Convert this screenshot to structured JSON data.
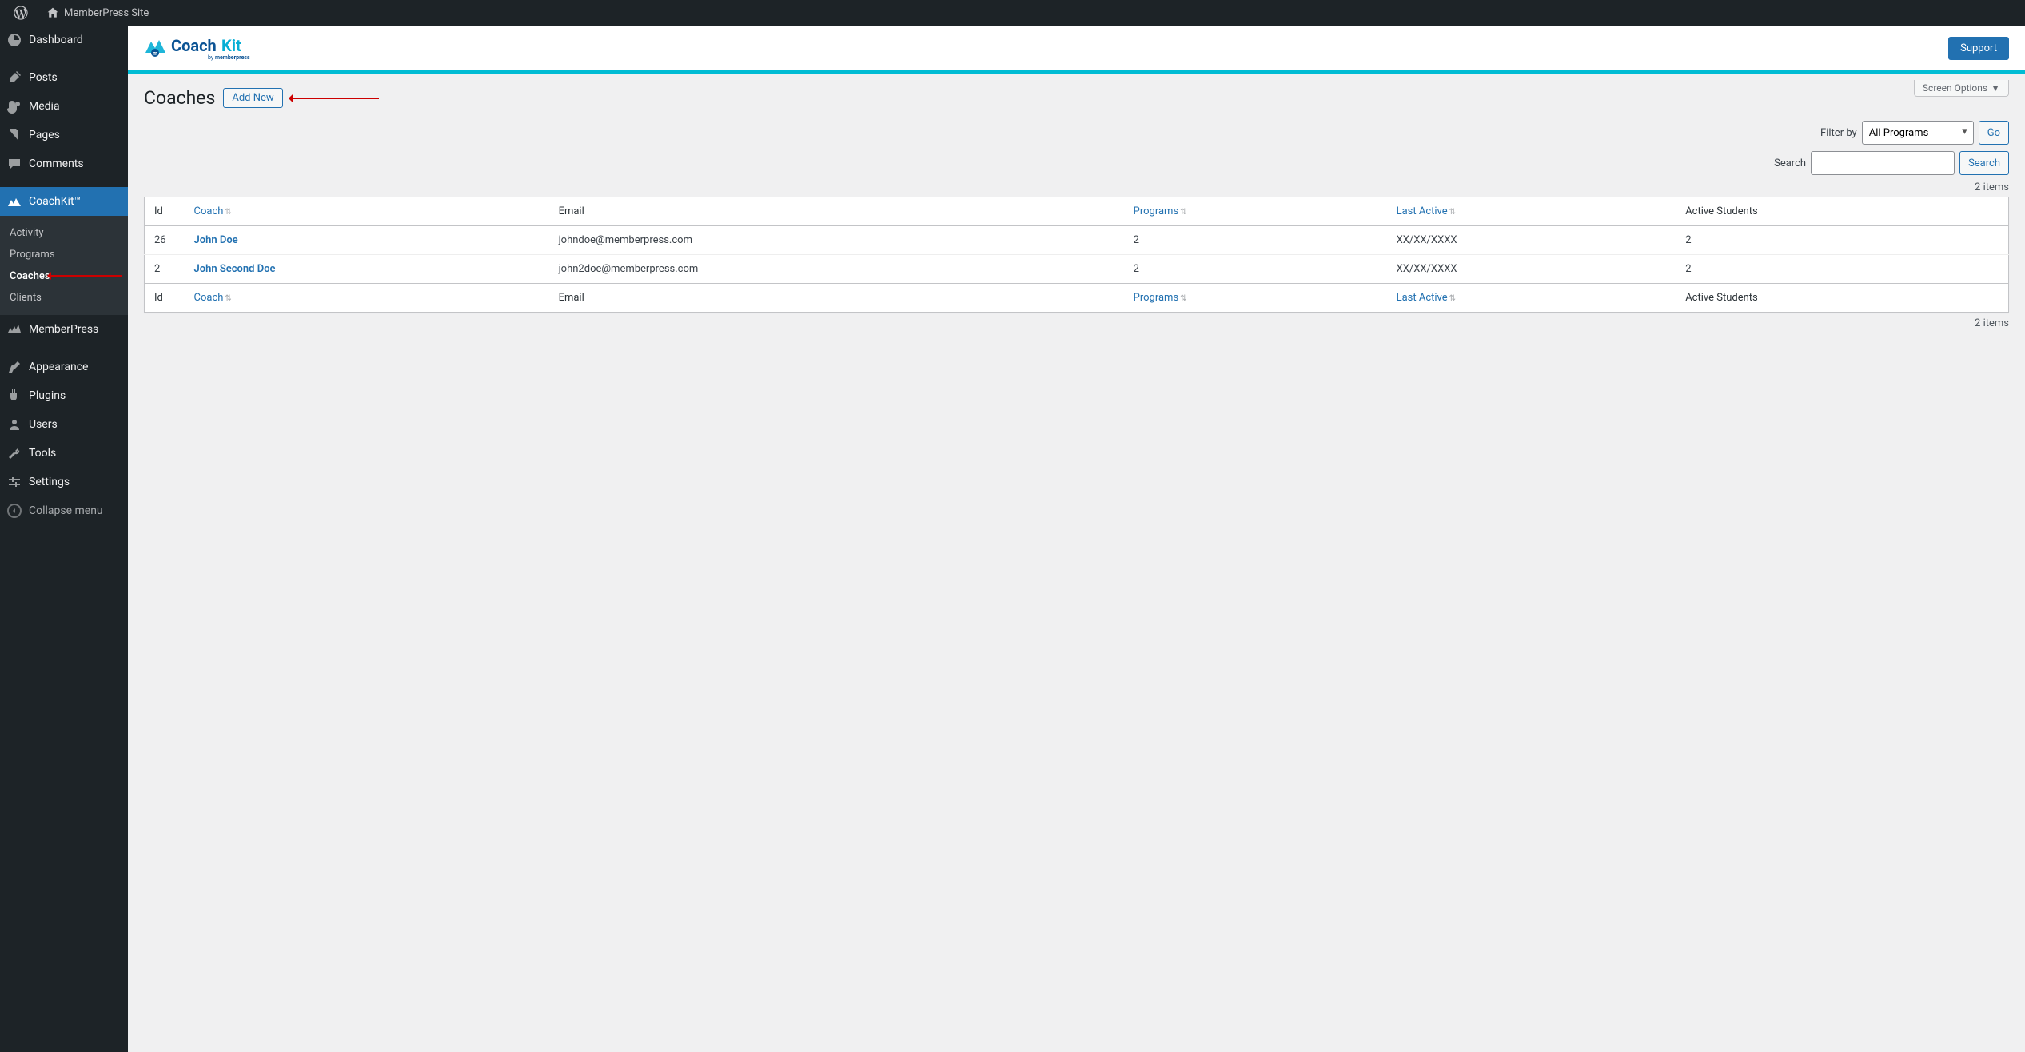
{
  "topbar": {
    "site_name": "MemberPress Site"
  },
  "sidebar": {
    "dashboard": "Dashboard",
    "posts": "Posts",
    "media": "Media",
    "pages": "Pages",
    "comments": "Comments",
    "coachkit": "CoachKit™",
    "sub": {
      "activity": "Activity",
      "programs": "Programs",
      "coaches": "Coaches",
      "clients": "Clients"
    },
    "memberpress": "MemberPress",
    "appearance": "Appearance",
    "plugins": "Plugins",
    "users": "Users",
    "tools": "Tools",
    "settings": "Settings",
    "collapse": "Collapse menu"
  },
  "brand": {
    "logo_text": "CoachKit",
    "logo_sub": "by memberpress",
    "support": "Support"
  },
  "screen_options": "Screen Options",
  "page": {
    "title": "Coaches",
    "add_new": "Add New"
  },
  "filter": {
    "label": "Filter by",
    "selected": "All Programs",
    "go": "Go",
    "search_label": "Search",
    "search_btn": "Search"
  },
  "count_top": "2 items",
  "count_bottom": "2 items",
  "columns": {
    "id": "Id",
    "coach": "Coach",
    "email": "Email",
    "programs": "Programs",
    "last_active": "Last Active",
    "active_students": "Active Students"
  },
  "rows": [
    {
      "id": "26",
      "coach": "John Doe",
      "email": "johndoe@memberpress.com",
      "programs": "2",
      "last_active": "XX/XX/XXXX",
      "active_students": "2"
    },
    {
      "id": "2",
      "coach": "John Second Doe",
      "email": "john2doe@memberpress.com",
      "programs": "2",
      "last_active": "XX/XX/XXXX",
      "active_students": "2"
    }
  ]
}
